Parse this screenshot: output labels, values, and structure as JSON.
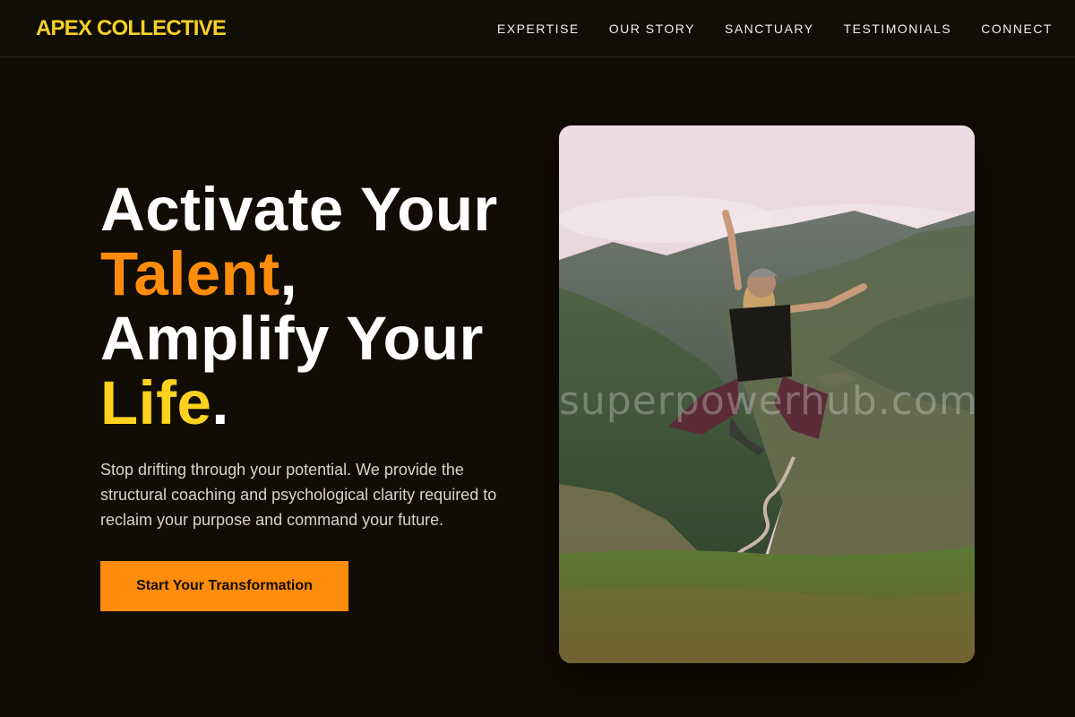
{
  "brand": {
    "logo": "APEX COLLECTIVE",
    "colors": {
      "background": "#120d04",
      "primary_orange": "#ff8c0a",
      "accent_yellow": "#ffd21f"
    }
  },
  "nav": {
    "items": [
      {
        "label": "EXPERTISE"
      },
      {
        "label": "OUR STORY"
      },
      {
        "label": "SANCTUARY"
      },
      {
        "label": "TESTIMONIALS"
      },
      {
        "label": "CONNECT"
      }
    ]
  },
  "hero": {
    "heading": {
      "line1": "Activate Your",
      "word_talent": "Talent",
      "comma": ",",
      "line3": "Amplify Your",
      "word_life": "Life",
      "period": "."
    },
    "subtext": "Stop drifting through your potential. We provide the structural coaching and psychological clarity required to reclaim your purpose and command your future.",
    "cta_label": "Start Your Transformation",
    "image": {
      "watermark": "superpowerhub.com"
    }
  }
}
